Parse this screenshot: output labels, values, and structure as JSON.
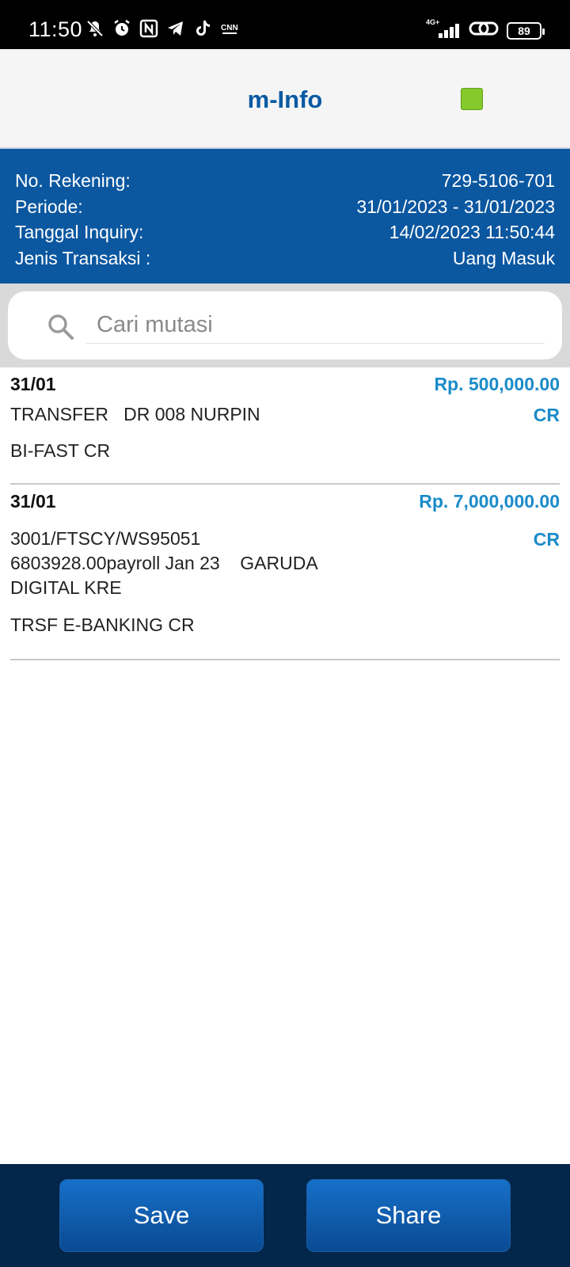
{
  "status_bar": {
    "time": "11:50",
    "battery": "89",
    "network": "4G+",
    "icons": [
      "mute-icon",
      "alarm-icon",
      "nfc-icon",
      "telegram-icon",
      "tiktok-icon",
      "cnn-icon",
      "signal-icon",
      "link-icon",
      "battery-icon"
    ]
  },
  "header": {
    "title": "m-Info",
    "status_color": "#86c92d"
  },
  "account": {
    "rows": [
      {
        "label": "No. Rekening:",
        "value": "729-5106-701"
      },
      {
        "label": "Periode:",
        "value": "31/01/2023 - 31/01/2023"
      },
      {
        "label": "Tanggal Inquiry:",
        "value": "14/02/2023 11:50:44"
      },
      {
        "label": "Jenis Transaksi :",
        "value": "Uang Masuk"
      }
    ]
  },
  "search": {
    "placeholder": "Cari mutasi",
    "value": ""
  },
  "transactions": [
    {
      "date": "31/01",
      "amount": "Rp. 500,000.00",
      "type": "CR",
      "description": "TRANSFER   DR 008 NURPIN",
      "channel": "BI-FAST CR"
    },
    {
      "date": "31/01",
      "amount": "Rp. 7,000,000.00",
      "type": "CR",
      "description": "3001/FTSCY/WS95051\n6803928.00payroll Jan 23    GARUDA\nDIGITAL KRE",
      "channel": "TRSF E-BANKING CR"
    }
  ],
  "actions": {
    "save_label": "Save",
    "share_label": "Share"
  },
  "colors": {
    "brand_blue": "#0b57a0",
    "amount_blue": "#1a8bc9",
    "bottom_bar": "#03264b"
  }
}
